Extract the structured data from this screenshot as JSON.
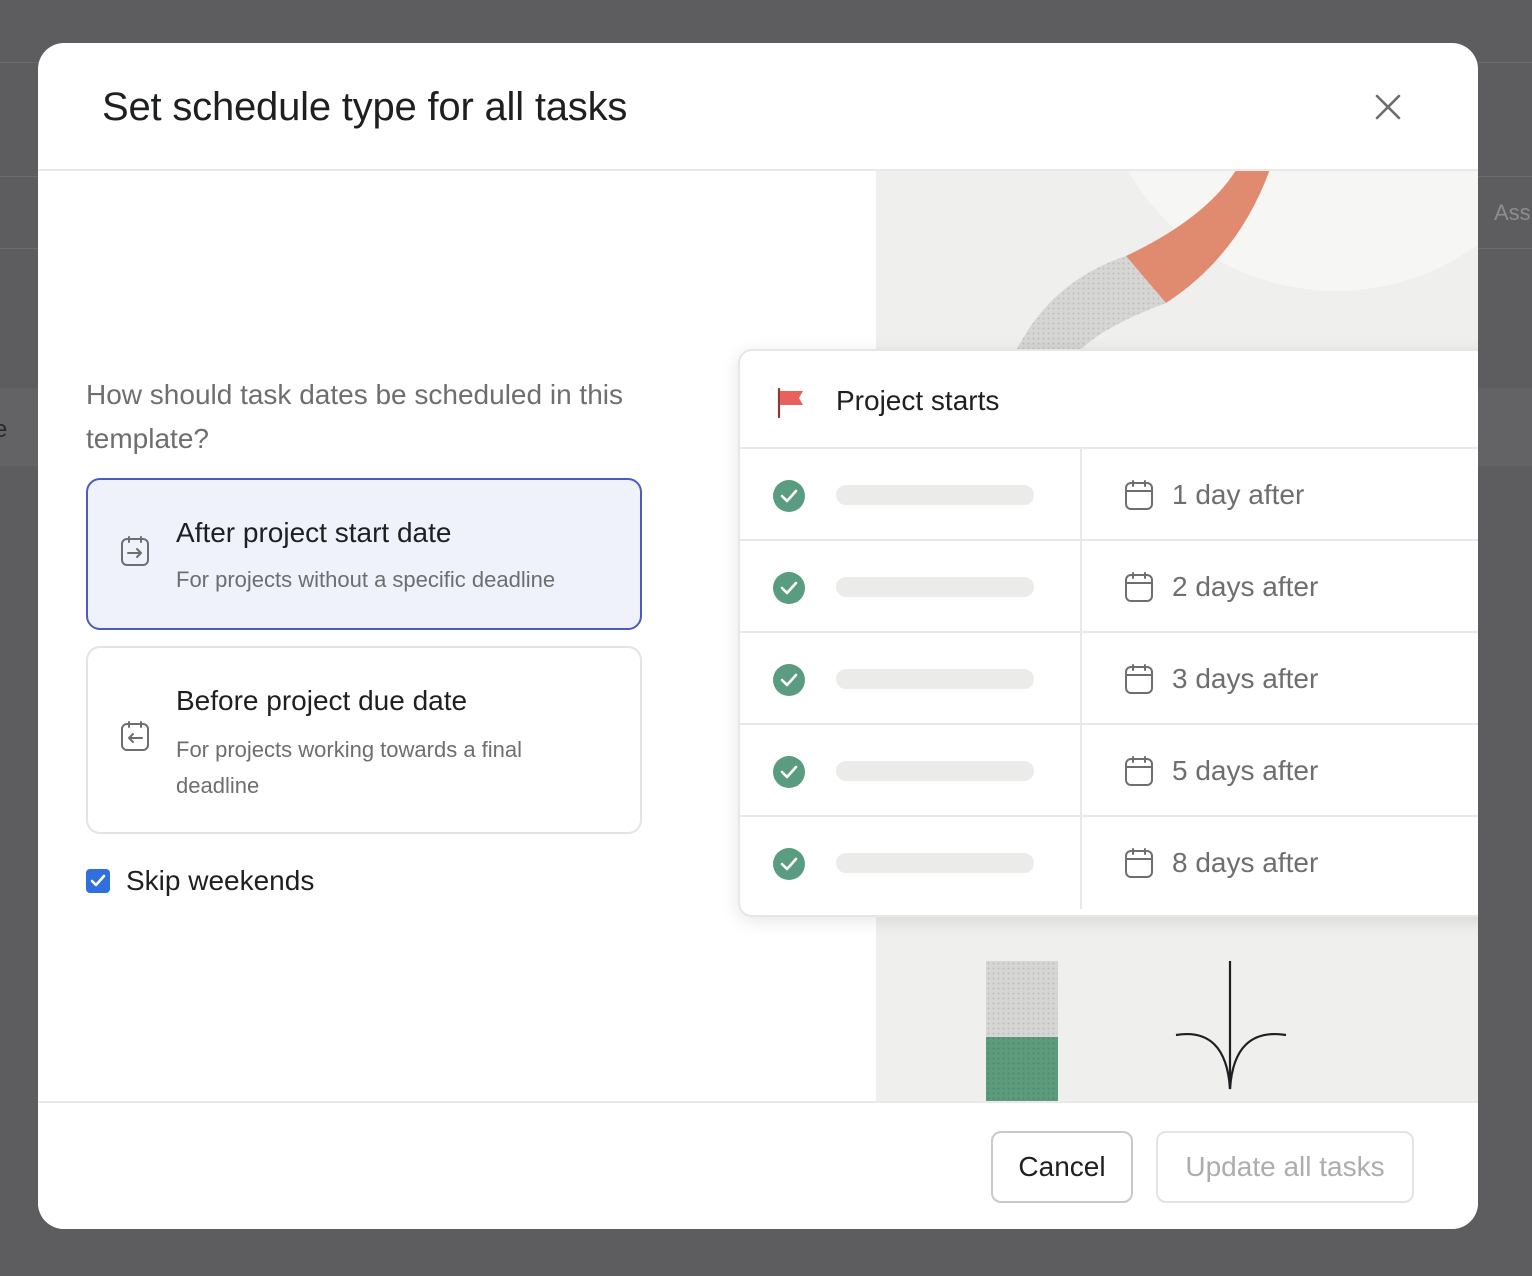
{
  "background": {
    "left_fragment": "e",
    "right_fragment": "Ass"
  },
  "dialog": {
    "title": "Set schedule type for all tasks",
    "close_icon": "close-icon",
    "question": "How should task dates be scheduled in this template?",
    "options": [
      {
        "title": "After project start date",
        "description": "For projects without a specific deadline",
        "icon": "arrow-into-calendar-icon",
        "selected": true
      },
      {
        "title": "Before project due date",
        "description": "For projects working towards a final deadline",
        "icon": "arrow-out-calendar-icon",
        "selected": false
      }
    ],
    "skip_weekends": {
      "label": "Skip weekends",
      "checked": true
    },
    "footer": {
      "cancel_label": "Cancel",
      "update_label": "Update all tasks"
    }
  },
  "illustration": {
    "header": "Project starts",
    "rows": [
      {
        "days": "1 day after"
      },
      {
        "days": "2 days after"
      },
      {
        "days": "3 days after"
      },
      {
        "days": "5 days after"
      },
      {
        "days": "8 days after"
      }
    ]
  },
  "colors": {
    "accent_blue": "#2f6fde",
    "selected_border": "#4a5cc0",
    "selected_bg": "#eff1fb",
    "check_green": "#5a9c80",
    "coral": "#e08b70",
    "flag_red": "#e8615a"
  }
}
